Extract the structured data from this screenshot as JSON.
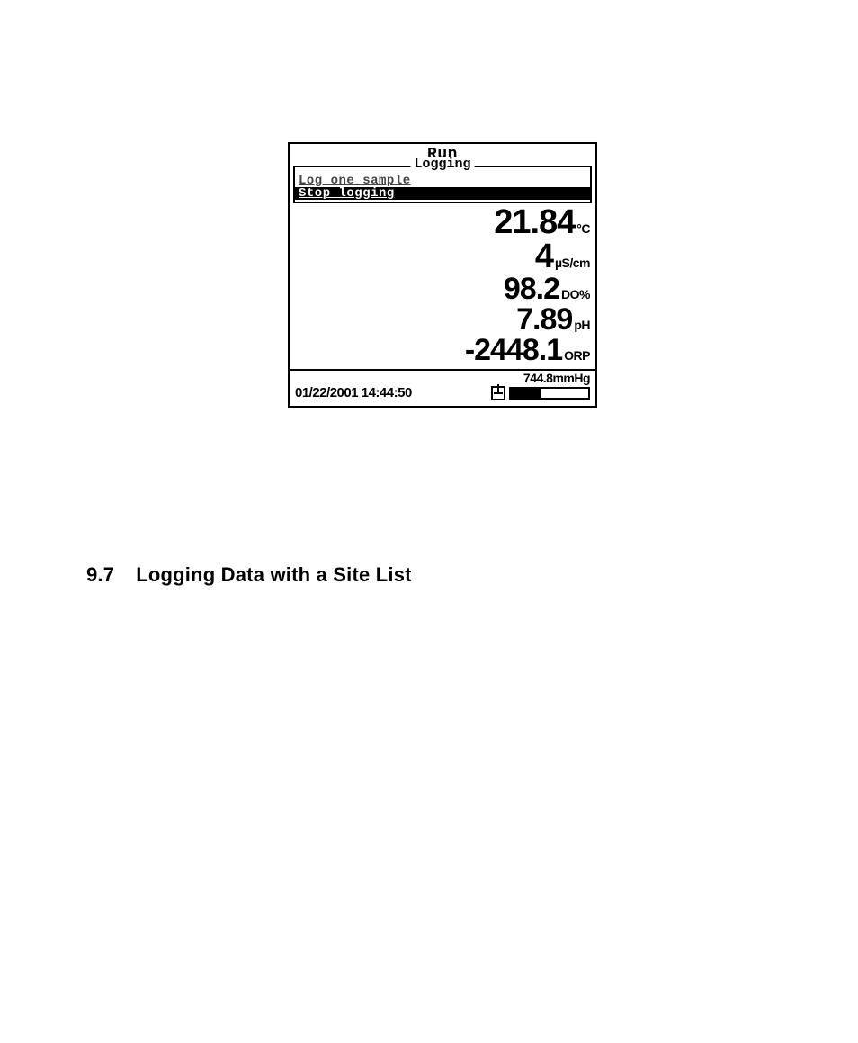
{
  "device": {
    "title": "Run",
    "menu": {
      "legend": "Logging",
      "items": [
        {
          "label": "Log one sample",
          "state": "dim"
        },
        {
          "label": "Stop logging",
          "state": "selected"
        }
      ]
    },
    "readings": [
      {
        "value": "21.84",
        "unit": "°C"
      },
      {
        "value": "4",
        "unit": "µS/cm"
      },
      {
        "value": "98.2",
        "unit": "DO%"
      },
      {
        "value": "7.89",
        "unit": "pH"
      },
      {
        "value": "-2448.1",
        "unit": "ORP"
      }
    ],
    "status": {
      "pressure": "744.8mmHg",
      "timestamp": "01/22/2001 14:44:50"
    }
  },
  "section": {
    "number": "9.7",
    "title": "Logging Data with a Site List"
  }
}
